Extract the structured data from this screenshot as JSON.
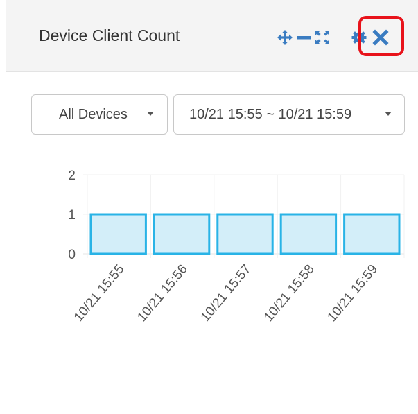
{
  "widget": {
    "title": "Device Client Count",
    "tools": [
      {
        "name": "move-icon",
        "icon": "four-arrows-move"
      },
      {
        "name": "minimize-icon",
        "icon": "minus"
      },
      {
        "name": "expand-icon",
        "icon": "expand-corners"
      },
      {
        "name": "settings-icon",
        "icon": "gear"
      },
      {
        "name": "close-icon",
        "icon": "x"
      }
    ],
    "highlighted_tool": "close-icon"
  },
  "filters": {
    "device_select": "All Devices",
    "time_range_select": "10/21 15:55 ~ 10/21 15:59"
  },
  "colors": {
    "accent": "#3a7cc1",
    "bar_fill": "#d3eef9",
    "bar_stroke": "#29b3e6",
    "highlight": "#e8131b"
  },
  "chart_data": {
    "type": "bar",
    "categories": [
      "10/21 15:55",
      "10/21 15:56",
      "10/21 15:57",
      "10/21 15:58",
      "10/21 15:59"
    ],
    "values": [
      1,
      1,
      1,
      1,
      1
    ],
    "y_ticks": [
      "0",
      "1",
      "2"
    ],
    "ylim": [
      0,
      2
    ],
    "grid": true,
    "title": "",
    "xlabel": "",
    "ylabel": ""
  }
}
